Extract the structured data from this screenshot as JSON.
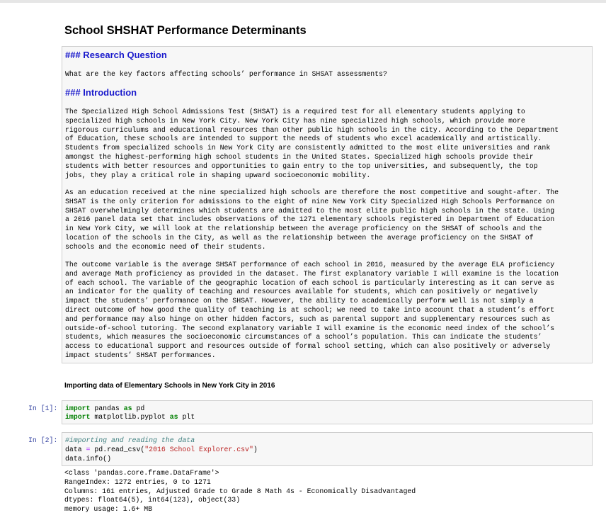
{
  "notebook": {
    "title": "School SHSHAT Performance Determinants",
    "markdown": {
      "research_heading": "### Research Question",
      "research_question": "What are the key factors affecting schools’ performance in SHSAT assessments?",
      "intro_heading": "### Introduction",
      "paragraph1": [
        "The Specialized High School Admissions Test (SHSAT) is a required test for all elementary students applying to",
        "specialized high schools in New York City. New York City has nine specialized high schools, which provide more",
        "rigorous curriculums and educational resources than other public high schools in the city. According to the Department",
        "of Education, these schools are intended to support the needs of students who excel academically and artistically.",
        "Students from specialized schools in New York City are consistently admitted to the most elite universities and rank",
        "amongst the highest-performing high school students in the United States. Specialized high schools provide their",
        "students with better resources and opportunities to gain entry to the top universities, and subsequently, the top",
        "jobs, they play a critical role in shaping upward socioeconomic mobility."
      ],
      "paragraph2": [
        "As an education received at the nine specialized high schools are therefore the most competitive and sought-after. The",
        "SHSAT is the only criterion for admissions to the eight of nine New York City Specialized High Schools Performance on",
        "SHSAT overwhelmingly determines which students are admitted to the most elite public high schools in the state. Using",
        "a 2016 panel data set that includes observations of the 1271 elementary schools registered in Department of Education",
        "in New York City, we will look at the relationship between the average proficiency on the SHSAT of schools and the",
        "location of the schools in the City, as well as the relationship between the average proficiency on the SHSAT of",
        "schools and the economic need of their students."
      ],
      "paragraph3": [
        "The outcome variable is the average SHSAT performance of each school in 2016, measured by the average ELA proficiency",
        "and average Math proficiency as provided in the dataset. The first explanatory variable I will examine is the location",
        "of each school. The variable of the geographic location of each school is particularly interesting as it can serve as",
        "an indicator for the quality of teaching and resources available for students, which can positively or negatively",
        "impact the students’ performance on the SHSAT. However, the ability to academically perform well is not simply a",
        "direct outcome of how good the quality of teaching is at school; we need to take into account that a student’s effort",
        "and performance may also hinge on other hidden factors, such as parental support and supplementary resources such as",
        "outside-of-school tutoring. The second explanatory variable I will examine is the economic need index of the school’s",
        "students, which measures the socioeconomic circumstances of a school’s population. This can indicate the students’",
        "access to educational support and resources outside of formal school setting, which can also positively or adversely",
        "impact students’ SHSAT performances."
      ]
    },
    "subheading": "Importing data of Elementary Schools in New York City in 2016",
    "cell1": {
      "prompt": "In [1]:",
      "line1": {
        "kw1": "import",
        "mid": " pandas ",
        "kw2": "as",
        "end": " pd"
      },
      "line2": {
        "kw1": "import",
        "mid": " matplotlib.pyplot ",
        "kw2": "as",
        "end": " plt"
      }
    },
    "cell2": {
      "prompt": "In [2]:",
      "comment": "#importing and reading the data",
      "line2": {
        "a": "data ",
        "op": "=",
        "b": " pd.read_csv(",
        "str": "\"2016 School Explorer.csv\"",
        "c": ")"
      },
      "line3": "data.info()"
    },
    "output": [
      "<class 'pandas.core.frame.DataFrame'>",
      "RangeIndex: 1272 entries, 0 to 1271",
      "Columns: 161 entries, Adjusted Grade to Grade 8 Math 4s - Economically Disadvantaged",
      "dtypes: float64(5), int64(123), object(33)",
      "memory usage: 1.6+ MB"
    ]
  }
}
